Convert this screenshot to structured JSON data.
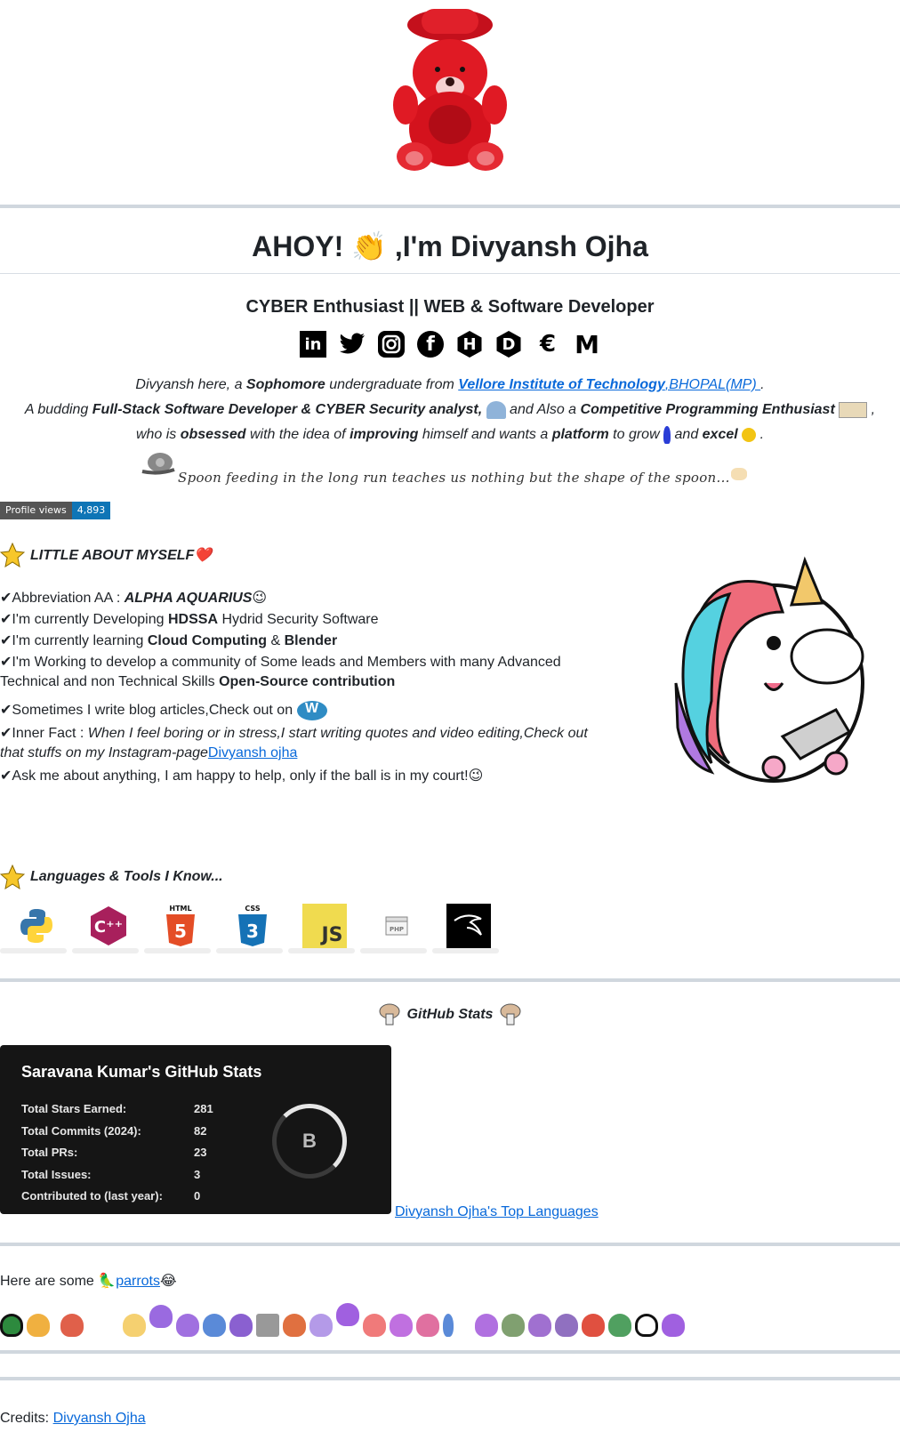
{
  "header": {
    "title_prefix": "AHOY! ",
    "title_wave": "👏",
    "title_suffix": " ,I'm Divyansh Ojha",
    "subtitle": "CYBER Enthusiast || WEB & Software Developer"
  },
  "socials": [
    {
      "icon": "linkedin-icon",
      "glyph": "in"
    },
    {
      "icon": "twitter-icon",
      "glyph": "🐦"
    },
    {
      "icon": "instagram-icon",
      "glyph": "◎"
    },
    {
      "icon": "facebook-icon",
      "glyph": "f"
    },
    {
      "icon": "hashnode-icon",
      "glyph": "H"
    },
    {
      "icon": "dev-icon",
      "glyph": "D"
    },
    {
      "icon": "leetcode-icon",
      "glyph": "€"
    },
    {
      "icon": "gmail-icon",
      "glyph": "M"
    }
  ],
  "intro": {
    "l1_a": "Divyansh here, a ",
    "l1_b": "Sophomore",
    "l1_c": " undergraduate from ",
    "l1_link_a": "Vellore Institute of Technology",
    "l1_link_b": ",BHOPAL(MP) ",
    "l1_d": ".",
    "l2_a": "A budding ",
    "l2_b": "Full-Stack Software Developer & CYBER Security analyst,",
    "l2_c": " and Also a ",
    "l2_d": "Competitive Programming Enthusiast",
    "l2_e": " ,",
    "l3_a": "who is ",
    "l3_b": "obsessed",
    "l3_c": " with the idea of ",
    "l3_d": "improving",
    "l3_e": " himself and wants a ",
    "l3_f": "platform",
    "l3_g": " to grow ",
    "l3_h": " and ",
    "l3_i": "excel",
    "l3_j": " .",
    "quote": "Spoon feeding in the long run teaches us nothing but the shape of the spoon..."
  },
  "badge": {
    "label": "Profile views",
    "value": "4,893"
  },
  "about": {
    "title": "LITTLE ABOUT MYSELF❤️",
    "tick": "✔",
    "items": [
      {
        "a": "Abbreviation AA : ",
        "b": "ALPHA AQUARIUS",
        "c": "😉"
      },
      {
        "a": "I'm currently Developing ",
        "b": "HDSSA",
        "c": " Hydrid Security Software"
      },
      {
        "a": "I'm currently learning ",
        "b": "Cloud Computing",
        "c": " & ",
        "d": "Blender"
      },
      {
        "a": "I'm Working to develop a community of Some leads and Members with many Advanced",
        "b": "Technical and non Technical Skills ",
        "c": "Open-Source contribution"
      },
      {
        "a": "Sometimes I write blog articles,Check out on "
      },
      {
        "a": "Inner Fact : ",
        "b": "When I feel boring or in stress,I start writing quotes and video editing,Check out",
        "c": "that stuffs on my Instagram-page",
        "link": "Divyansh ojha"
      },
      {
        "a": "Ask me about anything, I am happy to help, only if the ball is in my court!",
        "c": "😉"
      }
    ]
  },
  "languages": {
    "title": "Languages & Tools I Know...",
    "items": [
      {
        "icon": "python-icon",
        "label": "",
        "color": "#3776ab"
      },
      {
        "icon": "cplusplus-icon",
        "label": "C++",
        "color": "#a8205c"
      },
      {
        "icon": "html5-icon",
        "label": "5",
        "color": "#e44d26"
      },
      {
        "icon": "css3-icon",
        "label": "3",
        "color": "#1572b6"
      },
      {
        "icon": "javascript-icon",
        "label": "JS",
        "color": "#f0db4f"
      },
      {
        "icon": "php-icon",
        "label": "PHP",
        "color": "#999999"
      },
      {
        "icon": "kali-linux-icon",
        "label": "",
        "color": "#000000"
      }
    ]
  },
  "github": {
    "title": "GitHub Stats",
    "card_title": "Saravana Kumar's GitHub Stats",
    "rows": [
      {
        "label": "Total Stars Earned:",
        "value": "281"
      },
      {
        "label": "Total Commits (2024):",
        "value": "82"
      },
      {
        "label": "Total PRs:",
        "value": "23"
      },
      {
        "label": "Total Issues:",
        "value": "3"
      },
      {
        "label": "Contributed to (last year):",
        "value": "0"
      }
    ],
    "rank": "B",
    "top_langs_alt": "Divyansh Ojha's Top Languages"
  },
  "parrots": {
    "prefix": "Here are some ",
    "link": "parrots",
    "suffix": "😂",
    "bird": "🦜"
  },
  "credits": {
    "label": "Credits: ",
    "link": "Divyansh Ojha"
  }
}
